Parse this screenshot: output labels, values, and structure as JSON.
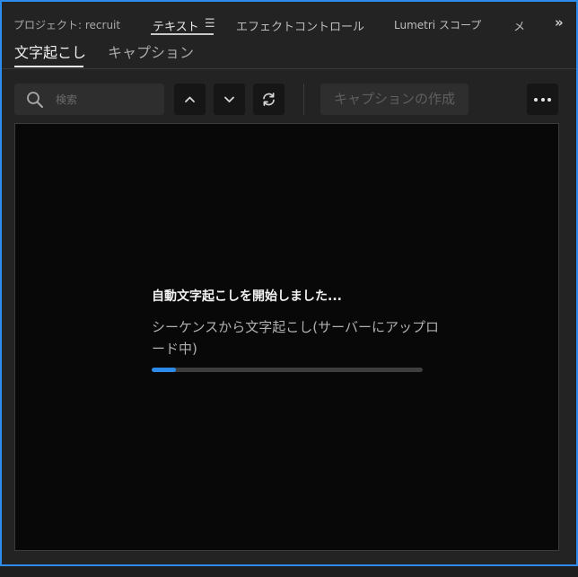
{
  "tabs": {
    "project": "プロジェクト: recruit",
    "text": "テキスト",
    "effect_controls": "エフェクトコントロール",
    "lumetri_scope": "Lumetri スコープ",
    "metadata_truncated": "メ",
    "overflow_icon": "chevron-double-right",
    "menu_icon": "hamburger"
  },
  "subtabs": {
    "transcript": "文字起こし",
    "captions": "キャプション"
  },
  "toolbar": {
    "search_placeholder": "検索",
    "search_value": "",
    "create_captions": "キャプションの作成",
    "up_icon": "chevron-up",
    "down_icon": "chevron-down",
    "refresh_icon": "refresh",
    "more_icon": "ellipsis"
  },
  "status": {
    "title": "自動文字起こしを開始しました...",
    "detail": "シーケンスから文字起こし(サーバーにアップロード中)",
    "progress_fraction": 0.09
  },
  "colors": {
    "accent": "#2d8ceb",
    "panel_bg": "#232323",
    "content_bg": "#080808"
  }
}
